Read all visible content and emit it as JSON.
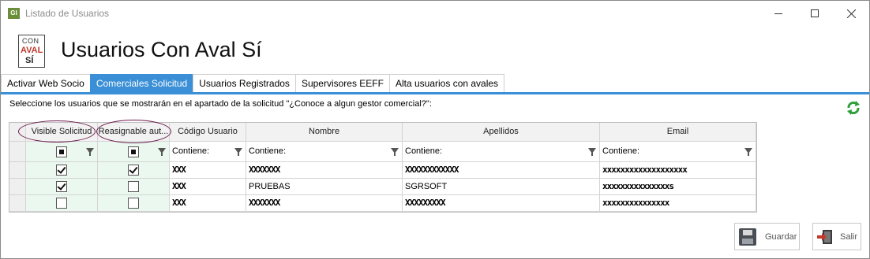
{
  "window": {
    "title": "Listado de Usuarios",
    "icon_text": "GI"
  },
  "logo": {
    "line1": "CON",
    "line2": "AVAL",
    "line3": "SÍ"
  },
  "header": {
    "title": "Usuarios Con Aval Sí"
  },
  "tabs": [
    {
      "label": "Activar Web Socio",
      "active": false
    },
    {
      "label": "Comerciales Solicitud",
      "active": true
    },
    {
      "label": "Usuarios Registrados",
      "active": false
    },
    {
      "label": "Supervisores EEFF",
      "active": false
    },
    {
      "label": "Alta usuarios con avales",
      "active": false
    }
  ],
  "instructions": "Seleccione los usuarios que se mostrarán en el apartado de la solicitud \"¿Conoce a algun gestor comercial?\":",
  "grid": {
    "columns": [
      "Visible Solicitud",
      "Reasignable aut...",
      "Código Usuario",
      "Nombre",
      "Apellidos",
      "Email"
    ],
    "filter_text": "Contiene:",
    "rows": [
      {
        "visible": true,
        "reasignable": true,
        "codigo": "XXX",
        "nombre": "XXXXXXX",
        "apellidos": "XXXXXXXXXXXX",
        "email": "xxxxxxxxxxxxxxxxxxx"
      },
      {
        "visible": true,
        "reasignable": false,
        "codigo": "XXX",
        "nombre": "PRUEBAS",
        "apellidos": "SGRSOFT",
        "email": "xxxxxxxxxxxxxxxs"
      },
      {
        "visible": false,
        "reasignable": false,
        "codigo": "XXX",
        "nombre": "XXXXXXX",
        "apellidos": "XXXXXXXXX",
        "email": "xxxxxxxxxxxxxxx"
      }
    ]
  },
  "buttons": {
    "save": "Guardar",
    "exit": "Salir"
  },
  "colors": {
    "accent": "#3a8fd6",
    "highlight_circle": "#6b1a4a",
    "checkbox_col_bg": "#eaf8ef"
  }
}
